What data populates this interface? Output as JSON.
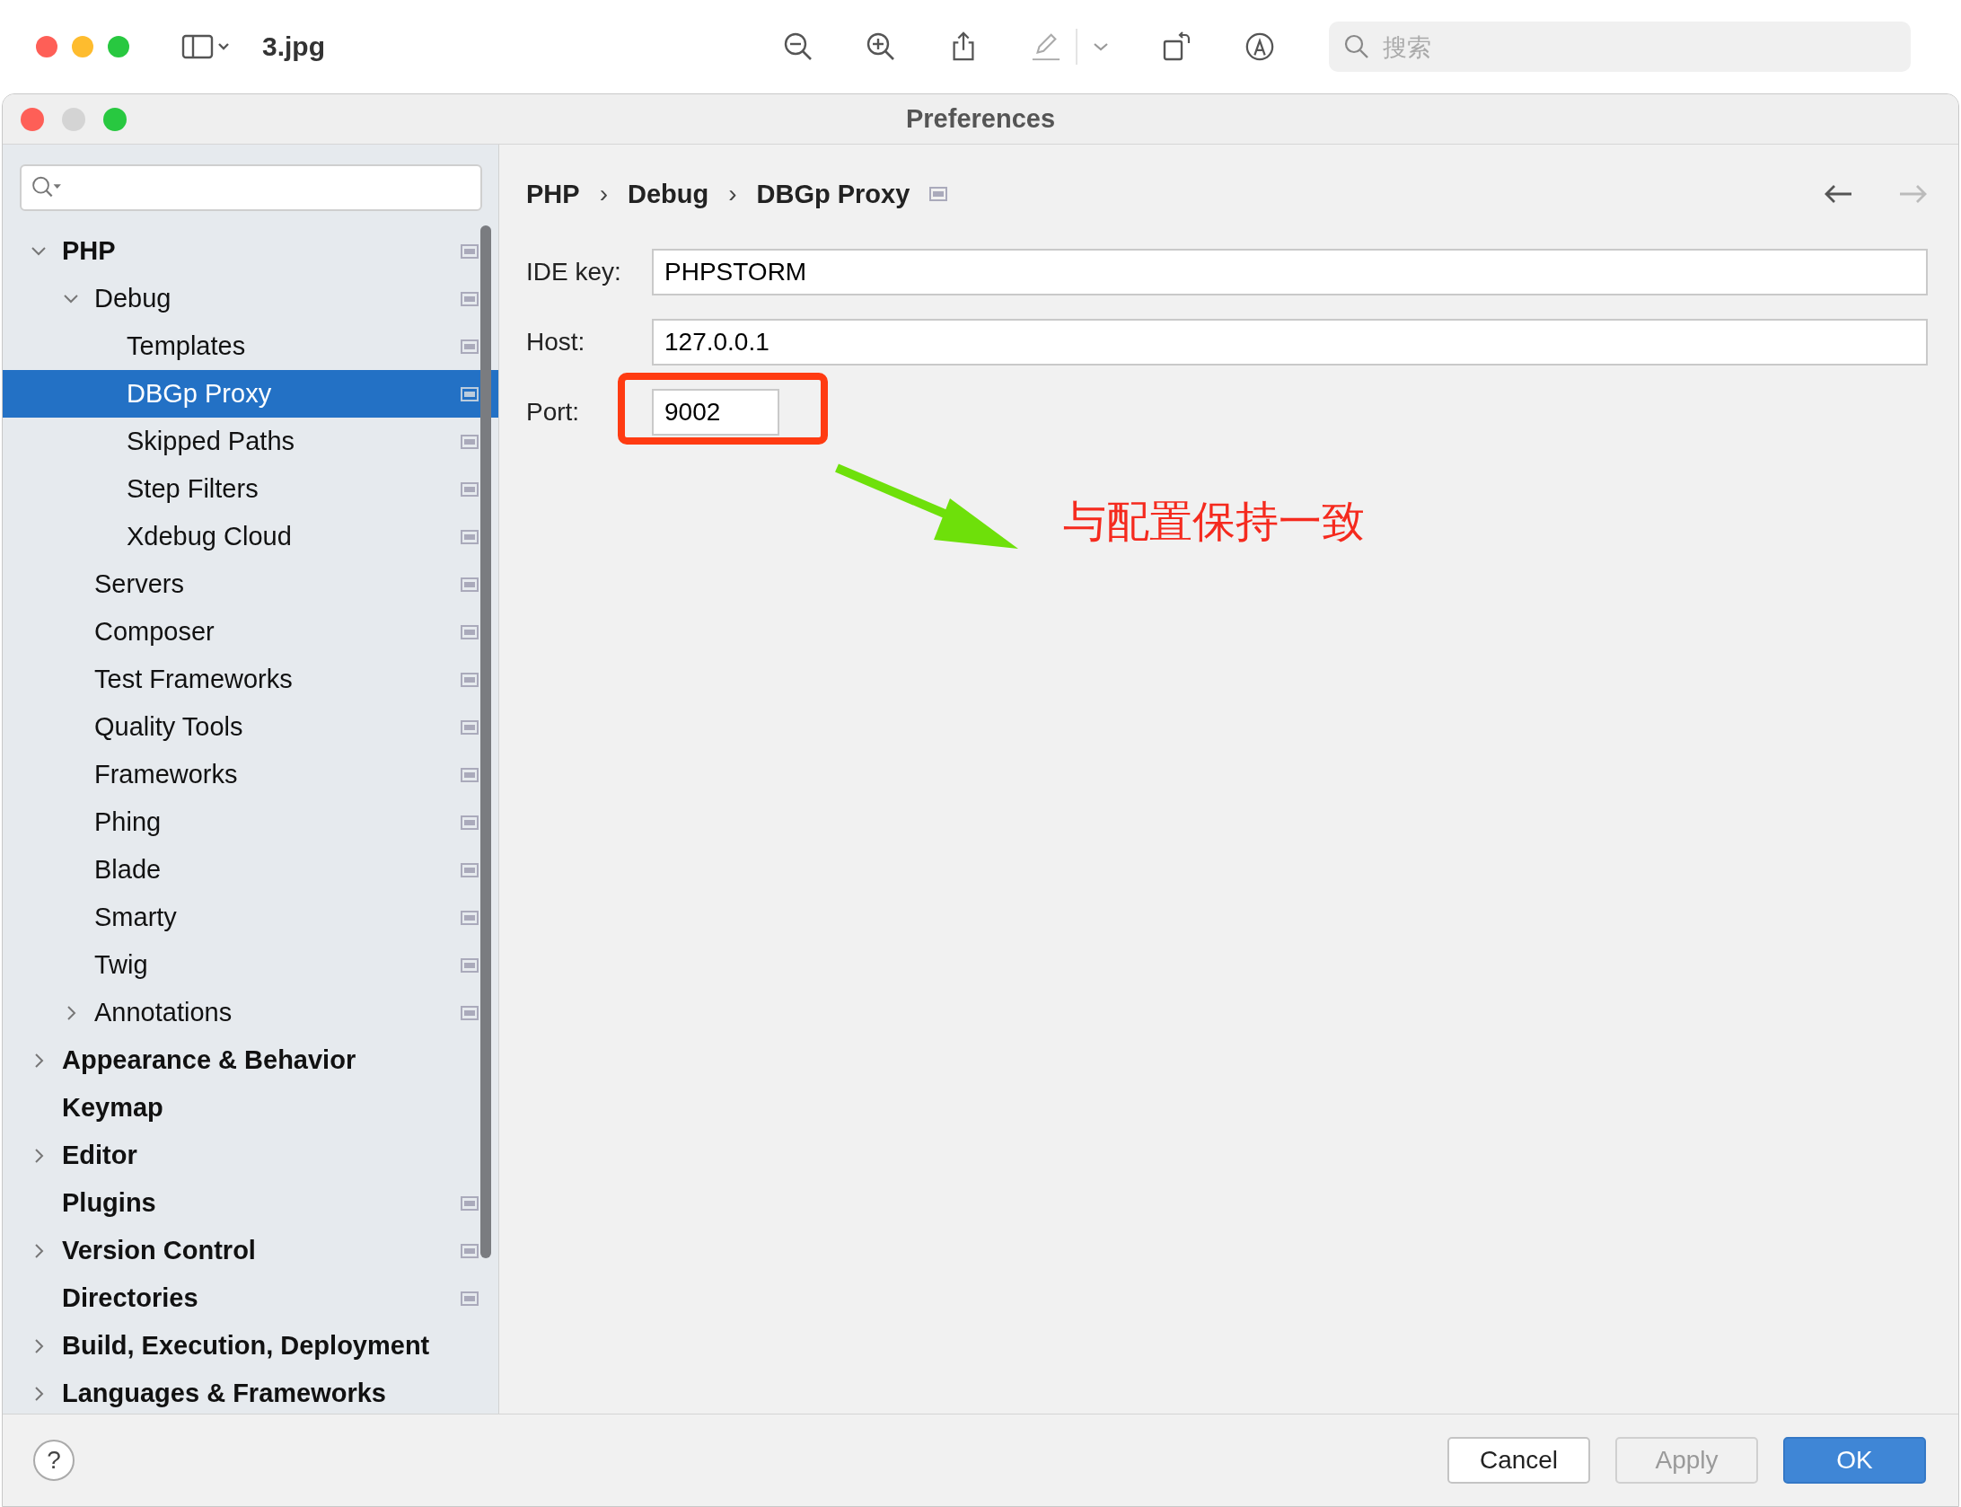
{
  "viewer": {
    "file_name": "3.jpg",
    "search": {
      "placeholder": "搜索"
    }
  },
  "window": {
    "title": "Preferences"
  },
  "sidebar": {
    "tree": [
      {
        "label": "PHP",
        "expanded": true,
        "selected": false,
        "project_icon": true,
        "children": [
          {
            "label": "Debug",
            "expanded": true,
            "selected": false,
            "project_icon": true,
            "children": [
              {
                "label": "Templates",
                "selected": false,
                "project_icon": true
              },
              {
                "label": "DBGp Proxy",
                "selected": true,
                "project_icon": true
              },
              {
                "label": "Skipped Paths",
                "selected": false,
                "project_icon": true
              },
              {
                "label": "Step Filters",
                "selected": false,
                "project_icon": true
              },
              {
                "label": "Xdebug Cloud",
                "selected": false,
                "project_icon": true
              }
            ]
          },
          {
            "label": "Servers",
            "selected": false,
            "project_icon": true
          },
          {
            "label": "Composer",
            "selected": false,
            "project_icon": true
          },
          {
            "label": "Test Frameworks",
            "selected": false,
            "project_icon": true
          },
          {
            "label": "Quality Tools",
            "selected": false,
            "project_icon": true
          },
          {
            "label": "Frameworks",
            "selected": false,
            "project_icon": true
          },
          {
            "label": "Phing",
            "selected": false,
            "project_icon": true
          },
          {
            "label": "Blade",
            "selected": false,
            "project_icon": true
          },
          {
            "label": "Smarty",
            "selected": false,
            "project_icon": true
          },
          {
            "label": "Twig",
            "selected": false,
            "project_icon": true
          },
          {
            "label": "Annotations",
            "expanded": false,
            "selected": false,
            "project_icon": true
          }
        ]
      },
      {
        "label": "Appearance & Behavior",
        "expanded": false,
        "selected": false,
        "project_icon": false
      },
      {
        "label": "Keymap",
        "selected": false,
        "project_icon": false
      },
      {
        "label": "Editor",
        "expanded": false,
        "selected": false,
        "project_icon": false
      },
      {
        "label": "Plugins",
        "selected": false,
        "project_icon": true
      },
      {
        "label": "Version Control",
        "expanded": false,
        "selected": false,
        "project_icon": true
      },
      {
        "label": "Directories",
        "selected": false,
        "project_icon": true
      },
      {
        "label": "Build, Execution, Deployment",
        "expanded": false,
        "selected": false,
        "project_icon": false
      },
      {
        "label": "Languages & Frameworks",
        "expanded": false,
        "selected": false,
        "project_icon": false
      }
    ]
  },
  "breadcrumb": [
    "PHP",
    "Debug",
    "DBGp Proxy"
  ],
  "separator": "›",
  "fields": [
    {
      "label": "IDE key:",
      "value": "PHPSTORM",
      "wide": true
    },
    {
      "label": "Host:",
      "value": "127.0.0.1",
      "wide": true
    },
    {
      "label": "Port:",
      "value": "9002",
      "wide": false
    }
  ],
  "annotation": {
    "text": "与配置保持一致"
  },
  "buttons": [
    {
      "label": "Cancel",
      "kind": "normal"
    },
    {
      "label": "Apply",
      "kind": "disabled"
    },
    {
      "label": "OK",
      "kind": "primary"
    }
  ],
  "help": "?"
}
